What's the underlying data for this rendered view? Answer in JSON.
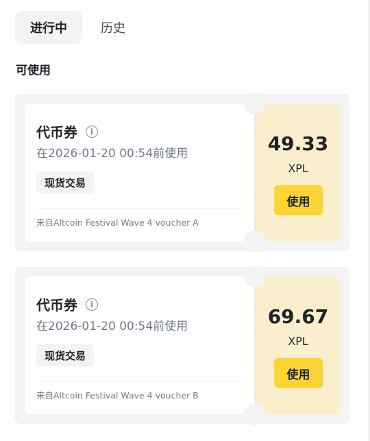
{
  "tabs": [
    {
      "label": "进行中",
      "active": true
    },
    {
      "label": "历史",
      "active": false
    }
  ],
  "section_title": "可使用",
  "icons": {
    "info": "info-icon"
  },
  "colors": {
    "accent_button": "#fcd535",
    "coupon_right_bg": "#faefcc",
    "card_bg": "#f3f3f3"
  },
  "vouchers": [
    {
      "title": "代币券",
      "expiry": "在2026-01-20 00:54前使用",
      "tag": "现货交易",
      "source": "来自Altcoin Festival Wave 4 voucher A",
      "amount": "49.33",
      "unit": "XPL",
      "button": "使用"
    },
    {
      "title": "代币券",
      "expiry": "在2026-01-20 00:54前使用",
      "tag": "现货交易",
      "source": "来自Altcoin Festival Wave 4 voucher B",
      "amount": "69.67",
      "unit": "XPL",
      "button": "使用"
    }
  ]
}
